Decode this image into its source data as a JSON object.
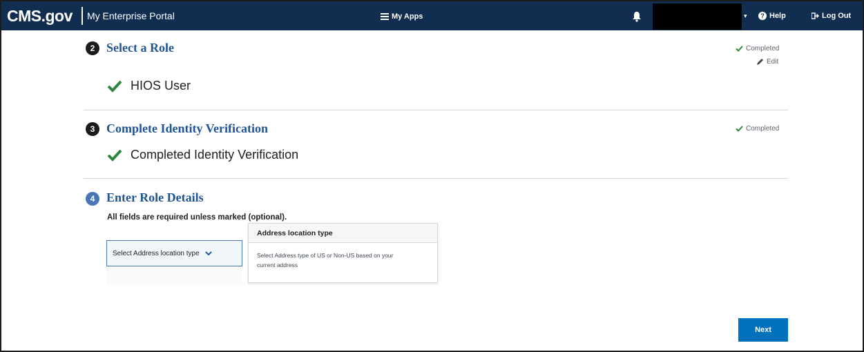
{
  "header": {
    "logo": "CMS.gov",
    "portal_name": "My Enterprise Portal",
    "my_apps_label": "My Apps",
    "help_label": "Help",
    "logout_label": "Log Out"
  },
  "steps": [
    {
      "number": "2",
      "title": "Select a Role",
      "status": "Completed",
      "edit_label": "Edit",
      "result": "HIOS User"
    },
    {
      "number": "3",
      "title": "Complete Identity Verification",
      "status": "Completed",
      "result": "Completed Identity Verification"
    },
    {
      "number": "4",
      "title": "Enter Role Details",
      "required_note": "All fields are required unless marked (optional).",
      "address_select": {
        "placeholder": "Select Address location type"
      },
      "tooltip": {
        "title": "Address location type",
        "body": "Select Address type of US or Non-US based on your current address"
      }
    }
  ],
  "actions": {
    "next_label": "Next"
  },
  "colors": {
    "header_bg": "#112e51",
    "title_blue": "#205493",
    "check_green": "#2e8540",
    "button_blue": "#0071bc",
    "active_step": "#4a77b4"
  },
  "icons": [
    "hamburger-icon",
    "bell-icon",
    "chevron-down-icon",
    "help-circle-icon",
    "logout-icon",
    "checkmark-icon",
    "pencil-icon"
  ]
}
